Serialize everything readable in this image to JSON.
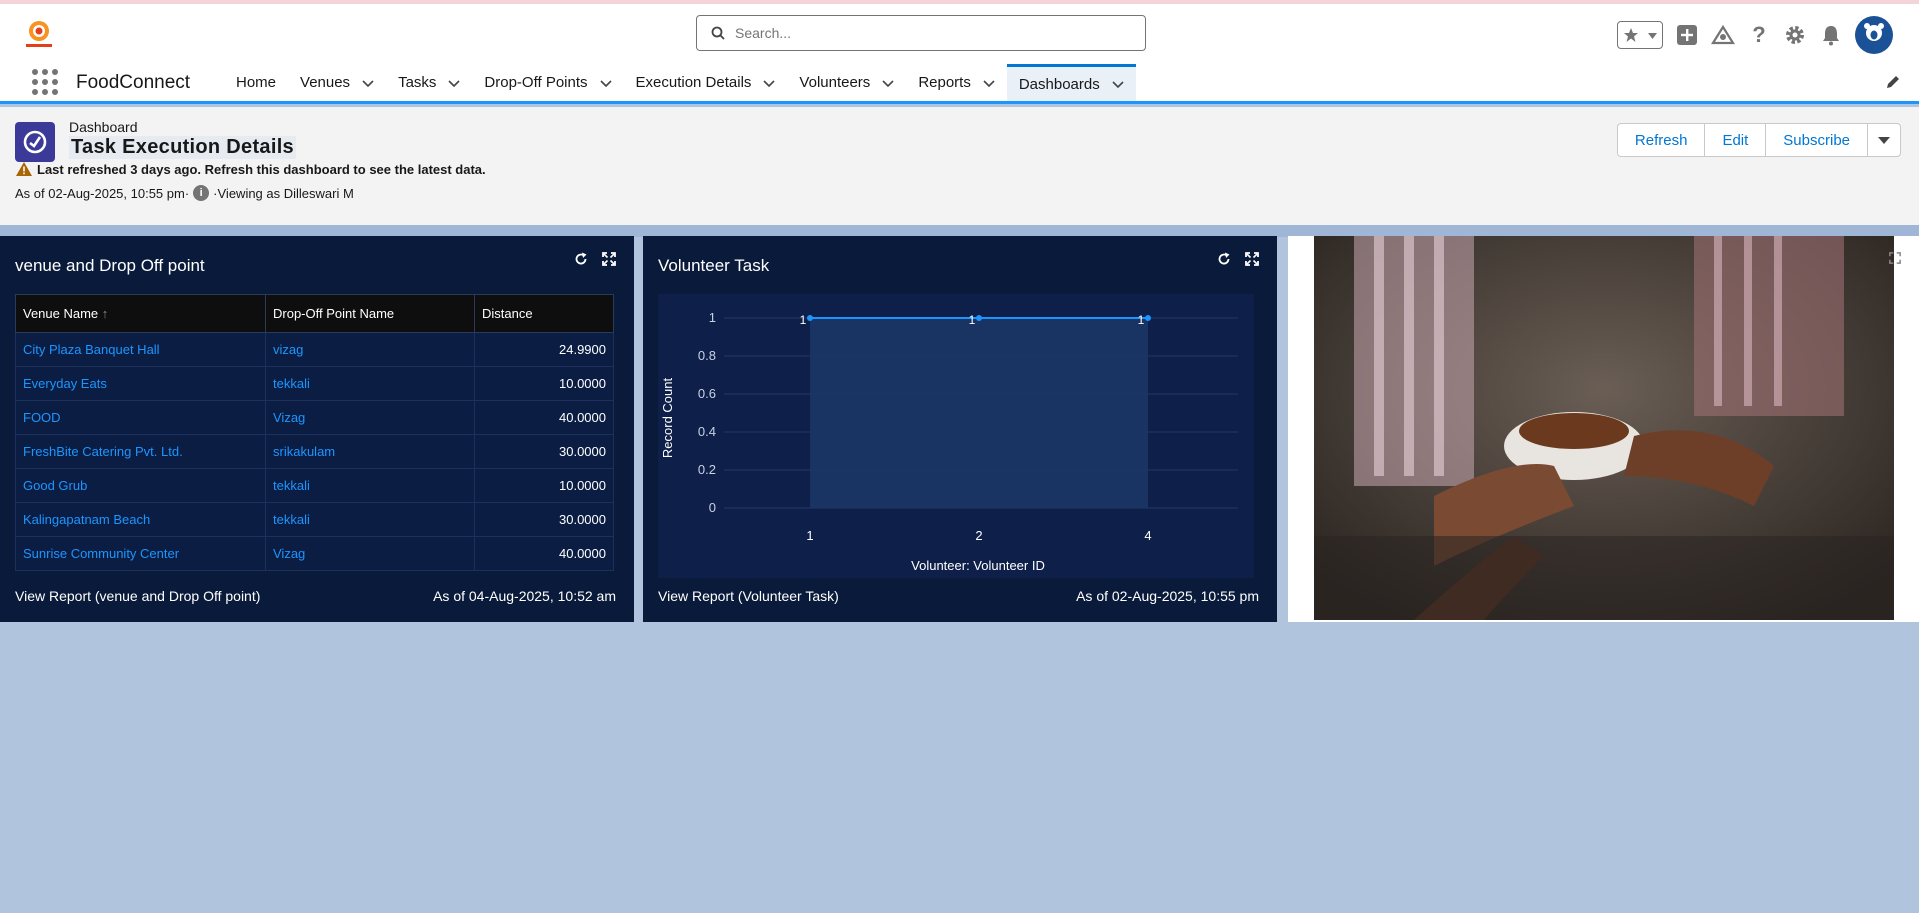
{
  "app": {
    "name": "FoodConnect",
    "logo_text": "FOOD CONNECT"
  },
  "search": {
    "placeholder": "Search..."
  },
  "nav": {
    "tabs": [
      {
        "label": "Home",
        "has_menu": false
      },
      {
        "label": "Venues",
        "has_menu": true
      },
      {
        "label": "Tasks",
        "has_menu": true
      },
      {
        "label": "Drop-Off Points",
        "has_menu": true
      },
      {
        "label": "Execution Details",
        "has_menu": true
      },
      {
        "label": "Volunteers",
        "has_menu": true
      },
      {
        "label": "Reports",
        "has_menu": true
      },
      {
        "label": "Dashboards",
        "has_menu": true,
        "active": true
      }
    ]
  },
  "dashboard": {
    "object_label": "Dashboard",
    "title": "Task Execution Details",
    "warning": "Last refreshed 3 days ago. Refresh this dashboard to see the latest data.",
    "as_of": "As of 02-Aug-2025, 10:55 pm·",
    "viewing_as": "·Viewing as Dilleswari M",
    "buttons": {
      "refresh": "Refresh",
      "edit": "Edit",
      "subscribe": "Subscribe"
    }
  },
  "table_card": {
    "title": "venue and Drop Off point",
    "columns": [
      "Venue Name",
      "Drop-Off Point Name",
      "Distance"
    ],
    "sort_indicator": "↑",
    "rows": [
      [
        "City Plaza Banquet Hall",
        "vizag",
        "24.9900"
      ],
      [
        "Everyday Eats",
        "tekkali",
        "10.0000"
      ],
      [
        "FOOD",
        "Vizag",
        "40.0000"
      ],
      [
        "FreshBite Catering Pvt. Ltd.",
        "srikakulam",
        "30.0000"
      ],
      [
        "Good Grub",
        "tekkali",
        "10.0000"
      ],
      [
        "Kalingapatnam Beach",
        "tekkali",
        "30.0000"
      ],
      [
        "Sunrise Community Center",
        "Vizag",
        "40.0000"
      ]
    ],
    "footer_link": "View Report (venue and Drop Off point)",
    "footer_asof": "As of 04-Aug-2025, 10:52 am"
  },
  "chart_card": {
    "title": "Volunteer Task",
    "footer_link": "View Report (Volunteer Task)",
    "footer_asof": "As of 02-Aug-2025, 10:55 pm"
  },
  "chart_data": {
    "type": "area",
    "categories": [
      "1",
      "2",
      "4"
    ],
    "values": [
      1,
      1,
      1
    ],
    "data_labels": [
      "1",
      "1",
      "1"
    ],
    "xlabel": "Volunteer: Volunteer ID",
    "ylabel": "Record Count",
    "ylim": [
      0,
      1
    ],
    "yticks": [
      "0",
      "0.2",
      "0.4",
      "0.6",
      "0.8",
      "1"
    ],
    "grid": true,
    "color": "#1b96ff"
  },
  "colors": {
    "brand": "#0176d3",
    "card_bg": "#0a1a3a",
    "link": "#1b96ff",
    "dashboard_icon": "#3c3a99"
  }
}
